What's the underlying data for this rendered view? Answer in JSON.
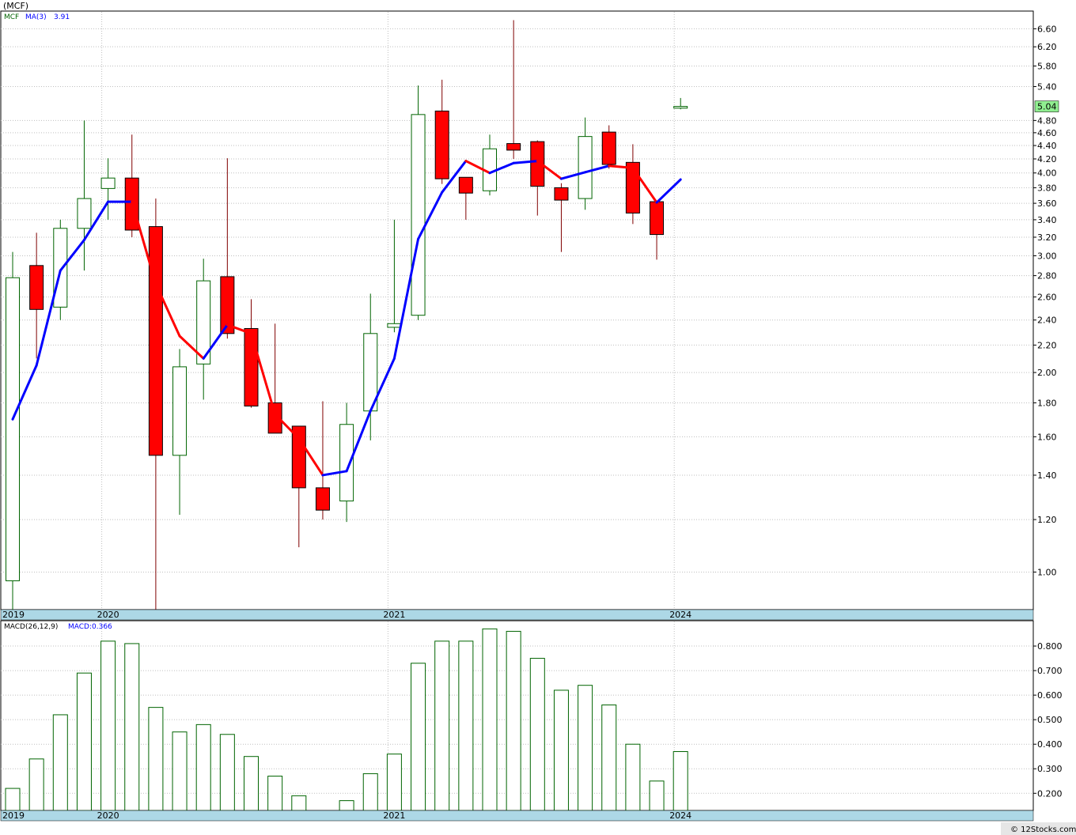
{
  "title": "(MCF)",
  "copyright": "© 12Stocks.com",
  "colors": {
    "up_border": "#006400",
    "down_fill": "#ff0000",
    "ma_up": "#0000ff",
    "ma_down": "#ff0000",
    "macd_bar": "#006400",
    "axis_band": "#add8e6",
    "last_price_bg": "#90ee90"
  },
  "price_panel": {
    "legend": {
      "ticker": "MCF",
      "ma_label": "MA(3)",
      "ma_value": "3.91"
    },
    "last_price": "5.04"
  },
  "macd_panel": {
    "legend": {
      "label": "MACD(26,12,9)",
      "value": "MACD:0.366"
    }
  },
  "chart_data": [
    {
      "type": "candlestick",
      "scale": "log",
      "ylim": [
        0.88,
        7.0
      ],
      "y_ticks": [
        "1.00",
        "1.20",
        "1.40",
        "1.60",
        "1.80",
        "2.00",
        "2.20",
        "2.40",
        "2.60",
        "2.80",
        "3.00",
        "3.20",
        "3.40",
        "3.60",
        "3.80",
        "4.00",
        "4.20",
        "4.40",
        "4.60",
        "4.80",
        "5.40",
        "5.80",
        "6.20",
        "6.60"
      ],
      "x_labels": [
        {
          "index": 0,
          "label": "2019"
        },
        {
          "index": 4,
          "label": "2020"
        },
        {
          "index": 16,
          "label": "2021"
        },
        {
          "index": 28,
          "label": "2024"
        }
      ],
      "candles": [
        {
          "o": 0.97,
          "h": 3.04,
          "l": 0.86,
          "c": 2.78
        },
        {
          "o": 2.9,
          "h": 3.25,
          "l": 2.1,
          "c": 2.49
        },
        {
          "o": 2.51,
          "h": 3.4,
          "l": 2.4,
          "c": 3.3
        },
        {
          "o": 3.3,
          "h": 4.8,
          "l": 2.85,
          "c": 3.66
        },
        {
          "o": 3.79,
          "h": 4.21,
          "l": 3.4,
          "c": 3.93
        },
        {
          "o": 3.93,
          "h": 4.57,
          "l": 3.2,
          "c": 3.28
        },
        {
          "o": 3.32,
          "h": 3.66,
          "l": 0.86,
          "c": 1.5
        },
        {
          "o": 1.5,
          "h": 2.17,
          "l": 1.22,
          "c": 2.04
        },
        {
          "o": 2.06,
          "h": 2.97,
          "l": 1.82,
          "c": 2.75
        },
        {
          "o": 2.79,
          "h": 4.21,
          "l": 2.25,
          "c": 2.29
        },
        {
          "o": 2.33,
          "h": 2.58,
          "l": 1.77,
          "c": 1.78
        },
        {
          "o": 1.8,
          "h": 2.37,
          "l": 1.62,
          "c": 1.62
        },
        {
          "o": 1.66,
          "h": 1.66,
          "l": 1.09,
          "c": 1.34
        },
        {
          "o": 1.34,
          "h": 1.81,
          "l": 1.2,
          "c": 1.24
        },
        {
          "o": 1.28,
          "h": 1.8,
          "l": 1.19,
          "c": 1.67
        },
        {
          "o": 1.75,
          "h": 2.63,
          "l": 1.58,
          "c": 2.29
        },
        {
          "o": 2.34,
          "h": 3.4,
          "l": 2.3,
          "c": 2.37
        },
        {
          "o": 2.44,
          "h": 5.42,
          "l": 2.4,
          "c": 4.9
        },
        {
          "o": 4.96,
          "h": 5.53,
          "l": 3.85,
          "c": 3.92
        },
        {
          "o": 3.94,
          "h": 3.94,
          "l": 3.4,
          "c": 3.73
        },
        {
          "o": 3.76,
          "h": 4.57,
          "l": 3.7,
          "c": 4.35
        },
        {
          "o": 4.43,
          "h": 6.8,
          "l": 4.2,
          "c": 4.33
        },
        {
          "o": 4.46,
          "h": 4.48,
          "l": 3.45,
          "c": 3.82
        },
        {
          "o": 3.8,
          "h": 3.86,
          "l": 3.04,
          "c": 3.64
        },
        {
          "o": 3.66,
          "h": 4.85,
          "l": 3.52,
          "c": 4.54
        },
        {
          "o": 4.61,
          "h": 4.72,
          "l": 4.06,
          "c": 4.12
        },
        {
          "o": 4.15,
          "h": 4.42,
          "l": 3.35,
          "c": 3.48
        },
        {
          "o": 3.62,
          "h": 3.62,
          "l": 2.96,
          "c": 3.23
        },
        {
          "o": 5.01,
          "h": 5.19,
          "l": 4.99,
          "c": 5.04
        }
      ],
      "ma": [
        1.7,
        2.05,
        2.85,
        3.17,
        3.62,
        3.62,
        2.72,
        2.27,
        2.1,
        2.36,
        2.29,
        1.73,
        1.59,
        1.4,
        1.42,
        1.75,
        2.1,
        3.18,
        3.74,
        4.17,
        4.0,
        4.14,
        4.17,
        3.92,
        4.01,
        4.1,
        4.07,
        3.61,
        3.91
      ]
    },
    {
      "type": "bar",
      "series": [
        {
          "name": "MACD",
          "values": [
            0.22,
            0.34,
            0.52,
            0.69,
            0.82,
            0.81,
            0.55,
            0.45,
            0.48,
            0.44,
            0.35,
            0.27,
            0.19,
            0.12,
            0.17,
            0.28,
            0.36,
            0.73,
            0.82,
            0.82,
            0.87,
            0.86,
            0.75,
            0.62,
            0.64,
            0.56,
            0.4,
            0.25,
            0.37
          ]
        }
      ],
      "ylim": [
        0.13,
        0.9
      ],
      "y_ticks": [
        "0.200",
        "0.300",
        "0.400",
        "0.500",
        "0.600",
        "0.700",
        "0.800"
      ],
      "x_labels": [
        {
          "index": 0,
          "label": "2019"
        },
        {
          "index": 4,
          "label": "2020"
        },
        {
          "index": 16,
          "label": "2021"
        },
        {
          "index": 28,
          "label": "2024"
        }
      ]
    }
  ]
}
